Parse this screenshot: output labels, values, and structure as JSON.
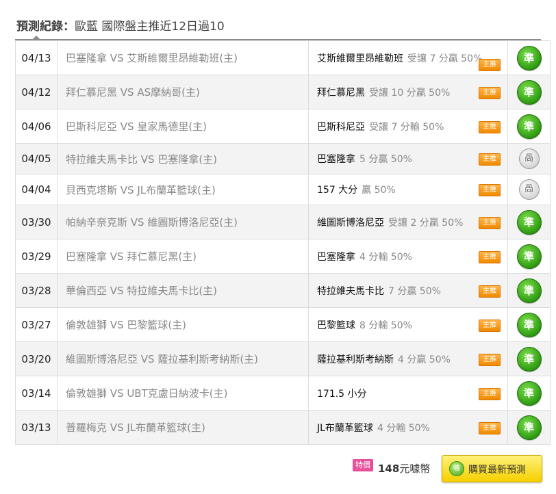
{
  "header": {
    "prefix": "預測紀錄：",
    "title": "歐藍 國際盤主推近12日過10"
  },
  "rows": [
    {
      "date": "04/13",
      "match": "巴塞隆拿 VS 艾斯維爾里昂維勒班(主)",
      "pick_team": "艾斯維爾里昂維勒班",
      "pick_odds": "受讓 7 分贏 50%",
      "tag": "主推",
      "result": "準"
    },
    {
      "date": "04/12",
      "match": "拜仁慕尼黑 VS AS摩納哥(主)",
      "pick_team": "拜仁慕尼黑",
      "pick_odds": "受讓 10 分贏 50%",
      "tag": "主推",
      "result": "準"
    },
    {
      "date": "04/06",
      "match": "巴斯科尼亞 VS 皇家馬德里(主)",
      "pick_team": "巴斯科尼亞",
      "pick_odds": "受讓 7 分輸 50%",
      "tag": "主推",
      "result": "準"
    },
    {
      "date": "04/05",
      "match": "特拉維夫馬卡比 VS 巴塞隆拿(主)",
      "pick_team": "巴塞隆拿",
      "pick_odds": "5 分贏 50%",
      "tag": "主推",
      "result": "咼"
    },
    {
      "date": "04/04",
      "match": "貝西克塔斯 VS JL布蘭革籃球(主)",
      "pick_team": "157 大分",
      "pick_odds": "贏 50%",
      "tag": "主推",
      "result": "咼"
    },
    {
      "date": "03/30",
      "match": "帕納辛奈克斯 VS 維圖斯博洛尼亞(主)",
      "pick_team": "維圖斯博洛尼亞",
      "pick_odds": "受讓 2 分贏 50%",
      "tag": "主推",
      "result": "準"
    },
    {
      "date": "03/29",
      "match": "巴塞隆拿 VS 拜仁慕尼黑(主)",
      "pick_team": "巴塞隆拿",
      "pick_odds": "4 分輸 50%",
      "tag": "主推",
      "result": "準"
    },
    {
      "date": "03/28",
      "match": "華倫西亞 VS 特拉維夫馬卡比(主)",
      "pick_team": "特拉維夫馬卡比",
      "pick_odds": "7 分贏 50%",
      "tag": "主推",
      "result": "準"
    },
    {
      "date": "03/27",
      "match": "倫敦雄獅 VS 巴黎籃球(主)",
      "pick_team": "巴黎籃球",
      "pick_odds": "8 分輸 50%",
      "tag": "主推",
      "result": "準"
    },
    {
      "date": "03/20",
      "match": "維圖斯博洛尼亞 VS 薩拉基利斯考納斯(主)",
      "pick_team": "薩拉基利斯考納斯",
      "pick_odds": "4 分贏 50%",
      "tag": "主推",
      "result": "準"
    },
    {
      "date": "03/14",
      "match": "倫敦雄獅 VS UBT克盧日納波卡(主)",
      "pick_team": "171.5 小分",
      "pick_odds": "",
      "tag": "主推",
      "result": "準"
    },
    {
      "date": "03/13",
      "match": "普羅梅克 VS JL布蘭革籃球(主)",
      "pick_team": "JL布蘭革籃球",
      "pick_odds": "4 分輸 50%",
      "tag": "主推",
      "result": "準"
    }
  ],
  "footer": {
    "special_label": "特價",
    "price": "148",
    "currency": "元噱幣",
    "coin_icon_text": "噱",
    "buy_label": "購買最新預測"
  },
  "colors": {
    "win_badge": "#2e9b12",
    "push_badge": "#d6d6d6",
    "tag": "#f08a00",
    "special": "#e84e9a",
    "buy_button": "#f6d000"
  }
}
